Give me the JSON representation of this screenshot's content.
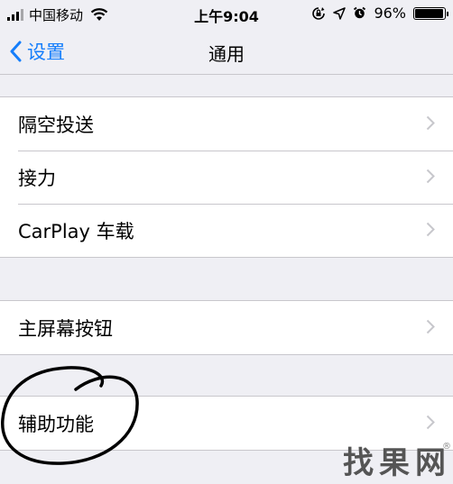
{
  "status_bar": {
    "carrier": "中国移动",
    "time": "上午9:04",
    "battery_text": "96%",
    "battery_level": 0.96,
    "icons": [
      "signal-bars-icon",
      "wifi-icon",
      "orientation-lock-icon",
      "location-arrow-icon",
      "alarm-icon",
      "battery-icon"
    ]
  },
  "nav": {
    "back_label": "设置",
    "title": "通用",
    "accent": "#157efb"
  },
  "groups": [
    {
      "rows": [
        {
          "label": "隔空投送"
        },
        {
          "label": "接力"
        },
        {
          "label": "CarPlay 车载"
        }
      ]
    },
    {
      "rows": [
        {
          "label": "主屏幕按钮"
        }
      ]
    },
    {
      "rows": [
        {
          "label": "辅助功能"
        }
      ]
    }
  ],
  "watermark": {
    "chars": [
      "找",
      "果",
      "网"
    ],
    "registered": "®"
  }
}
